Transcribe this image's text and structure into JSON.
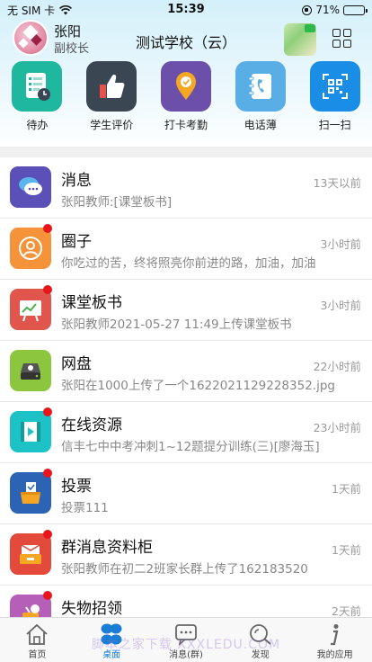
{
  "status": {
    "carrier": "无 SIM 卡",
    "time": "15:39",
    "battery": "71%",
    "battery_level": 0.71
  },
  "header": {
    "user_name": "张阳",
    "user_role": "副校长",
    "school_title": "测试学校（云）"
  },
  "quick_actions": [
    {
      "label": "待办",
      "icon": "todo-icon",
      "color": "#1fb89e"
    },
    {
      "label": "学生评价",
      "icon": "thumbs-up-icon",
      "color": "#3a4652"
    },
    {
      "label": "打卡考勤",
      "icon": "location-pin-icon",
      "color": "#6c4fa8"
    },
    {
      "label": "电话薄",
      "icon": "phone-book-icon",
      "color": "#5aaee6"
    },
    {
      "label": "扫一扫",
      "icon": "qr-scan-icon",
      "color": "#1a8ee6"
    }
  ],
  "list": [
    {
      "title": "消息",
      "subtitle": "张阳教师:[课堂板书]",
      "time": "13天以前",
      "icon": "chat-bubbles-icon",
      "color": "#5b4fb8",
      "unread": false
    },
    {
      "title": "圈子",
      "subtitle": "你吃过的苦，终将照亮你前进的路，加油，加油",
      "time": "3小时前",
      "icon": "circle-people-icon",
      "color": "#f4933a",
      "unread": true
    },
    {
      "title": "课堂板书",
      "subtitle": "张阳教师2021-05-27 11:49上传课堂板书",
      "time": "3小时前",
      "icon": "blackboard-icon",
      "color": "#e0554c",
      "unread": true
    },
    {
      "title": "网盘",
      "subtitle": "张阳在1000上传了一个1622021129228352.jpg",
      "time": "22小时前",
      "icon": "hard-disk-icon",
      "color": "#8cc63f",
      "unread": false
    },
    {
      "title": "在线资源",
      "subtitle": "信丰七中中考冲刺1~12题提分训练(三)[廖海玉]",
      "time": "23小时前",
      "icon": "video-film-icon",
      "color": "#1cc2c5",
      "unread": true
    },
    {
      "title": "投票",
      "subtitle": "投票111",
      "time": "1天前",
      "icon": "ballot-box-icon",
      "color": "#2d63b5",
      "unread": true
    },
    {
      "title": "群消息资料柜",
      "subtitle": "张阳教师在初二2班家长群上传了162183520",
      "time": "1天前",
      "icon": "mail-cabinet-icon",
      "color": "#e34a3c",
      "unread": true
    },
    {
      "title": "失物招领",
      "subtitle": "",
      "time": "2天前",
      "icon": "lost-found-icon",
      "color": "#b55fb8",
      "unread": true
    }
  ],
  "tabs": [
    {
      "label": "首页",
      "icon": "home-icon",
      "active": false
    },
    {
      "label": "桌面",
      "icon": "desktop-icon",
      "active": true
    },
    {
      "label": "消息(群)",
      "icon": "message-icon",
      "active": false
    },
    {
      "label": "发现",
      "icon": "discover-icon",
      "active": false
    },
    {
      "label": "我的应用",
      "icon": "info-icon",
      "active": false
    }
  ],
  "watermark": "脚本之家下载 XXXLEDU.COM"
}
